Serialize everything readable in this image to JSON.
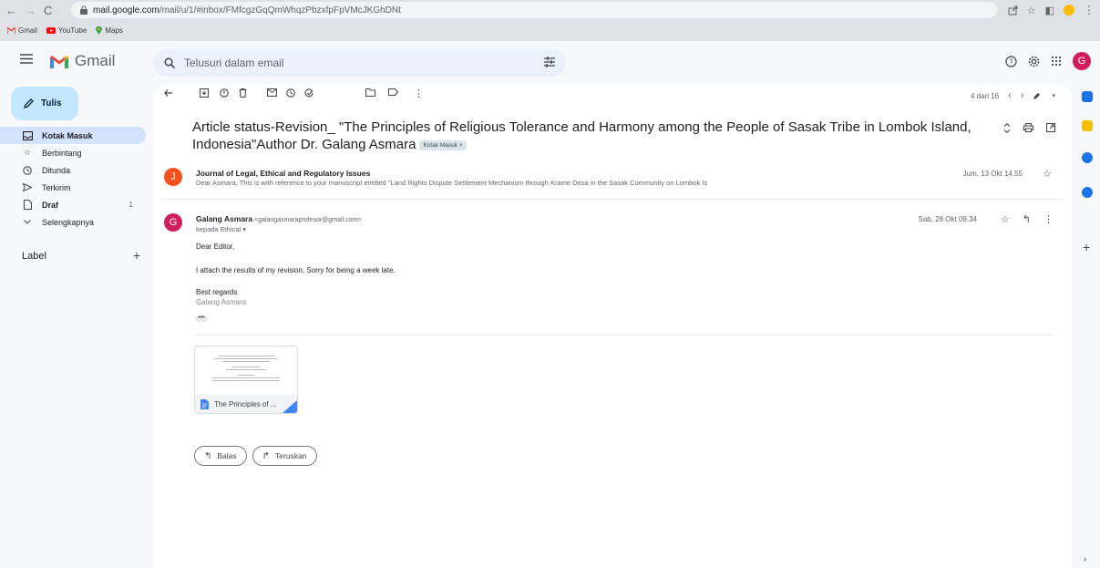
{
  "browser": {
    "url_host": "mail.google.com",
    "url_path": "/mail/u/1/#inbox/FMfcgzGqQmWhqzPbzxfpFpVMcJKGhDNt",
    "bookmarks": [
      "Gmail",
      "YouTube",
      "Maps"
    ]
  },
  "header": {
    "app_name": "Gmail",
    "search_placeholder": "Telusuri dalam email",
    "avatar_letter": "G"
  },
  "sidebar": {
    "compose_label": "Tulis",
    "items": [
      {
        "label": "Kotak Masuk",
        "icon": "inbox-icon",
        "active": true
      },
      {
        "label": "Berbintang",
        "icon": "star-icon"
      },
      {
        "label": "Ditunda",
        "icon": "clock-icon"
      },
      {
        "label": "Terkirim",
        "icon": "send-icon"
      },
      {
        "label": "Draf",
        "icon": "draft-icon",
        "count": "1"
      },
      {
        "label": "Selengkapnya",
        "icon": "chevron-down-icon"
      }
    ],
    "label_heading": "Label"
  },
  "toolbar": {
    "pager_text": "4 dari 16"
  },
  "thread": {
    "subject": "Article status-Revision_ \"The Principles of Religious Tolerance and Harmony among the People of Sasak Tribe in Lombok Island, Indonesia\"Author Dr. Galang Asmara",
    "label_chip": "Kotak Masuk ×",
    "message1": {
      "avatar_letter": "J",
      "avatar_color": "#f4511e",
      "sender": "Journal of Legal, Ethical and Regulatory Issues",
      "snippet": "Dear Asmara, This is with reference to your manuscript entitled \"Land Rights Dispute Settlement Mechanism through Krame Desa in the Sasak Community on Lombok Is",
      "date": "Jum, 13 Okt 14.55"
    },
    "message2": {
      "avatar_letter": "G",
      "avatar_color": "#d01e5a",
      "sender_name": "Galang Asmara",
      "sender_email": "<galangasmaraprofesor@gmail.com>",
      "to_line": "kepada Ethical ▾",
      "date": "Sab, 28 Okt 09.34",
      "greeting": "Dear Editor,",
      "body": "I attach the results of my revision, Sorry for being a week late.",
      "closing": "Best regards",
      "signature": "Galang Asmara",
      "ellipsis": "•••",
      "attachment_name": "The Principles of ..."
    }
  },
  "actions": {
    "reply_label": "Balas",
    "forward_label": "Teruskan"
  },
  "colors": {
    "accent": "#0b57d0",
    "compose_bg": "#c2e7ff",
    "active_nav_bg": "#d3e3fd"
  }
}
